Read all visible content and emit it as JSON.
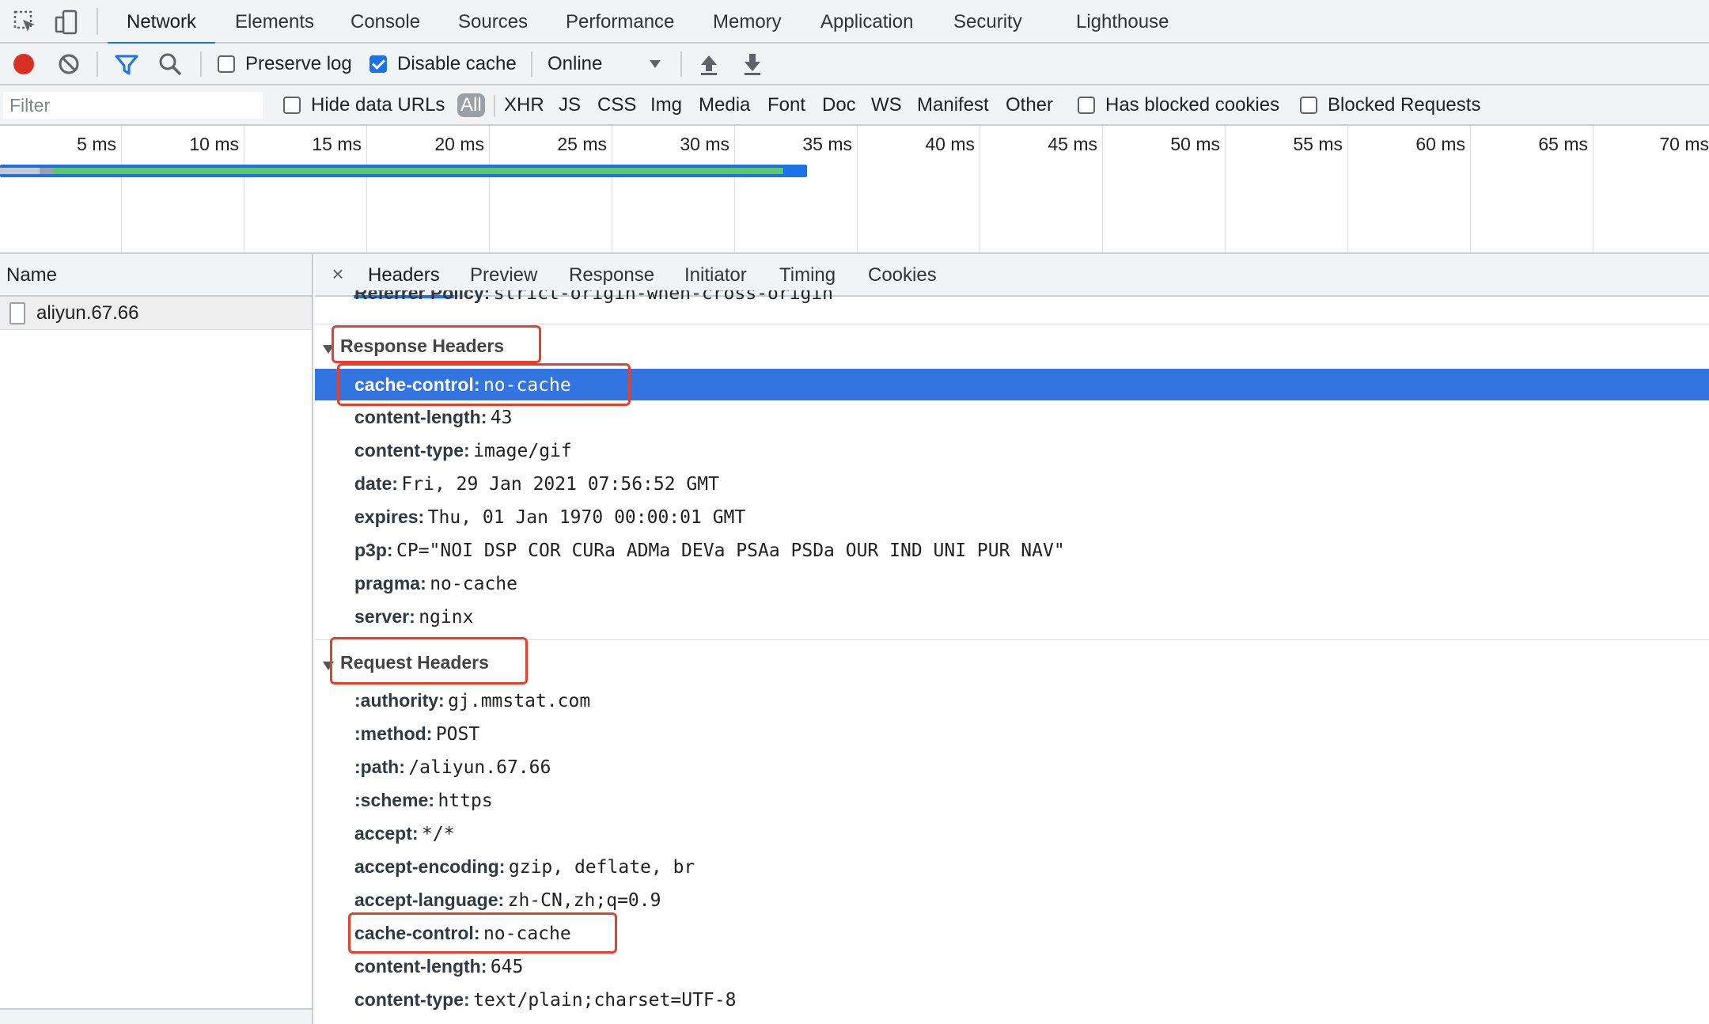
{
  "tabbar": {
    "tabs": [
      {
        "label": "Network",
        "active": true
      },
      {
        "label": "Elements"
      },
      {
        "label": "Console"
      },
      {
        "label": "Sources"
      },
      {
        "label": "Performance"
      },
      {
        "label": "Memory"
      },
      {
        "label": "Application"
      },
      {
        "label": "Security"
      },
      {
        "label": "Lighthouse"
      }
    ]
  },
  "toolbar": {
    "preserve_log_label": "Preserve log",
    "preserve_log_checked": false,
    "disable_cache_label": "Disable cache",
    "disable_cache_checked": true,
    "throttle_value": "Online"
  },
  "filterbar": {
    "filter_placeholder": "Filter",
    "hide_data_urls_label": "Hide data URLs",
    "types": [
      "All",
      "XHR",
      "JS",
      "CSS",
      "Img",
      "Media",
      "Font",
      "Doc",
      "WS",
      "Manifest",
      "Other"
    ],
    "selected_type": "All",
    "has_blocked_cookies_label": "Has blocked cookies",
    "blocked_requests_label": "Blocked Requests"
  },
  "timeline": {
    "ticks": [
      "5 ms",
      "10 ms",
      "15 ms",
      "20 ms",
      "25 ms",
      "30 ms",
      "35 ms",
      "40 ms",
      "45 ms",
      "50 ms",
      "55 ms",
      "60 ms",
      "65 ms",
      "70 ms"
    ]
  },
  "namepane": {
    "header": "Name",
    "rows": [
      "aliyun.67.66"
    ]
  },
  "detail": {
    "tabs": [
      {
        "label": "Headers",
        "active": true
      },
      {
        "label": "Preview"
      },
      {
        "label": "Response"
      },
      {
        "label": "Initiator"
      },
      {
        "label": "Timing"
      },
      {
        "label": "Cookies"
      }
    ],
    "partial_row": {
      "key": "Referrer Policy:",
      "value": "strict-origin-when-cross-origin"
    },
    "response_headers": {
      "title": "Response Headers",
      "rows": [
        {
          "key": "cache-control:",
          "value": "no-cache"
        },
        {
          "key": "content-length:",
          "value": "43"
        },
        {
          "key": "content-type:",
          "value": "image/gif"
        },
        {
          "key": "date:",
          "value": "Fri, 29 Jan 2021 07:56:52 GMT"
        },
        {
          "key": "expires:",
          "value": "Thu, 01 Jan 1970 00:00:01 GMT"
        },
        {
          "key": "p3p:",
          "value": "CP=\"NOI DSP COR CURa ADMa DEVa PSAa PSDa OUR IND UNI PUR NAV\""
        },
        {
          "key": "pragma:",
          "value": "no-cache"
        },
        {
          "key": "server:",
          "value": "nginx"
        }
      ]
    },
    "request_headers": {
      "title": "Request Headers",
      "rows": [
        {
          "key": ":authority:",
          "value": "gj.mmstat.com"
        },
        {
          "key": ":method:",
          "value": "POST"
        },
        {
          "key": ":path:",
          "value": "/aliyun.67.66"
        },
        {
          "key": ":scheme:",
          "value": "https"
        },
        {
          "key": "accept:",
          "value": "*/*"
        },
        {
          "key": "accept-encoding:",
          "value": "gzip, deflate, br"
        },
        {
          "key": "accept-language:",
          "value": "zh-CN,zh;q=0.9"
        },
        {
          "key": "cache-control:",
          "value": "no-cache"
        },
        {
          "key": "content-length:",
          "value": "645"
        },
        {
          "key": "content-type:",
          "value": "text/plain;charset=UTF-8"
        }
      ]
    }
  },
  "colors": {
    "accent": "#1a73e8",
    "selected_row": "#3275e0",
    "annotation_red": "#e2412e",
    "record_red": "#d93025",
    "waterfall_green": "#5ec768"
  }
}
